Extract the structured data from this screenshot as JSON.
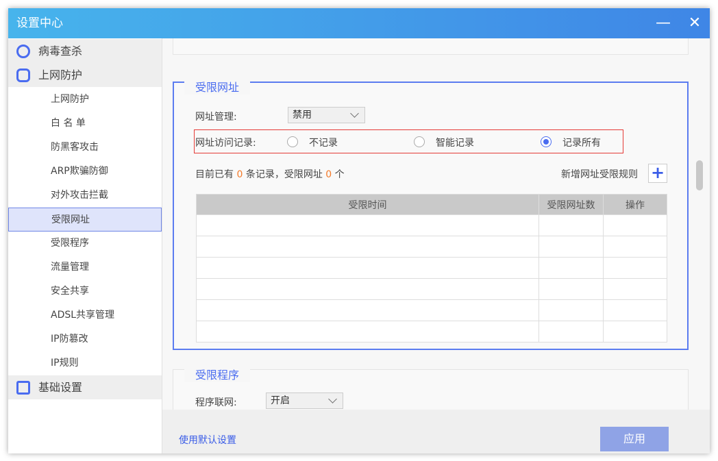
{
  "window": {
    "title": "设置中心",
    "minimize": "—",
    "close": "✕"
  },
  "sidebar": {
    "groups": [
      {
        "label": "病毒查杀",
        "icon": "virus-scan-icon"
      },
      {
        "label": "上网防护",
        "icon": "web-protect-icon"
      },
      {
        "label": "基础设置",
        "icon": "settings-icon"
      }
    ],
    "items": [
      "上网防护",
      "白 名 单",
      "防黑客攻击",
      "ARP欺骗防御",
      "对外攻击拦截",
      "受限网址",
      "受限程序",
      "流量管理",
      "安全共享",
      "ADSL共享管理",
      "IP防篡改",
      "IP规则"
    ],
    "selected": "受限网址"
  },
  "restricted_url": {
    "legend": "受限网址",
    "mgmt_label": "网址管理:",
    "mgmt_value": "禁用",
    "log_label": "网址访问记录:",
    "options": [
      "不记录",
      "智能记录",
      "记录所有"
    ],
    "selected_option": "记录所有",
    "count_prefix": "目前已有",
    "record_count": "0",
    "count_mid": "条记录，受限网址",
    "url_count": "0",
    "count_suffix": "个",
    "add_rule_label": "新增网址受限规则",
    "add_icon": "+",
    "table_headers": [
      "受限时间",
      "受限网址数",
      "操作"
    ]
  },
  "restricted_program": {
    "legend": "受限程序",
    "net_label": "程序联网:",
    "net_value": "开启"
  },
  "footer": {
    "default_link": "使用默认设置",
    "apply": "应用"
  }
}
